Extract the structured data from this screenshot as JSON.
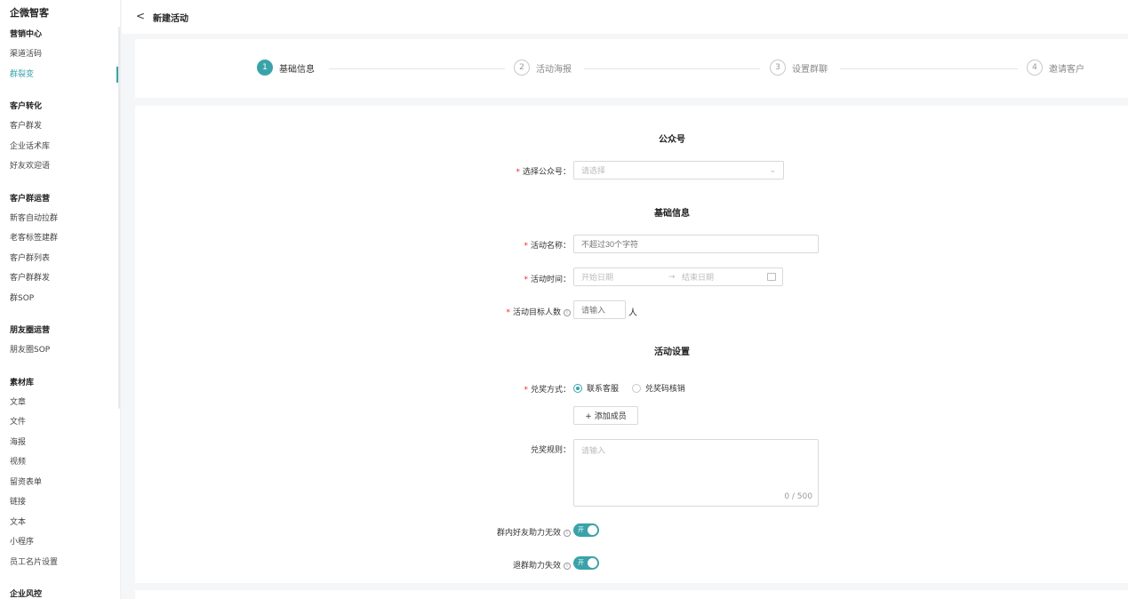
{
  "app": {
    "brand": "企微智客"
  },
  "header": {
    "back": "<",
    "title": "新建活动"
  },
  "sidebar": {
    "groups": [
      {
        "title": "营销中心",
        "items": [
          "渠道活码",
          "群裂变"
        ]
      },
      {
        "title": "客户转化",
        "items": [
          "客户群发",
          "企业话术库",
          "好友欢迎语"
        ]
      },
      {
        "title": "客户群运营",
        "items": [
          "新客自动拉群",
          "老客标签建群",
          "客户群列表",
          "客户群群发",
          "群SOP"
        ]
      },
      {
        "title": "朋友圈运营",
        "items": [
          "朋友圈SOP"
        ]
      },
      {
        "title": "素材库",
        "items": [
          "文章",
          "文件",
          "海报",
          "视频",
          "留资表单",
          "链接",
          "文本",
          "小程序",
          "员工名片设置"
        ]
      },
      {
        "title": "企业风控",
        "items": []
      }
    ],
    "active_item": "群裂变"
  },
  "steps": [
    {
      "num": "1",
      "label": "基础信息",
      "active": true
    },
    {
      "num": "2",
      "label": "活动海报",
      "active": false
    },
    {
      "num": "3",
      "label": "设置群聊",
      "active": false
    },
    {
      "num": "4",
      "label": "邀请客户",
      "active": false
    }
  ],
  "form": {
    "section_account": "公众号",
    "account_label": "选择公众号：",
    "account_placeholder": "请选择",
    "section_basic": "基础信息",
    "name_label": "活动名称：",
    "name_placeholder": "不超过30个字符",
    "time_label": "活动时间：",
    "start_placeholder": "开始日期",
    "arrow": "→",
    "end_placeholder": "结束日期",
    "target_label": "活动目标人数",
    "target_placeholder": "请输入",
    "target_unit": "人",
    "section_settings": "活动设置",
    "redeem_label": "兑奖方式：",
    "redeem_option1": "联系客服",
    "redeem_option2": "兑奖码核销",
    "add_member": "+ 添加成员",
    "rules_label": "兑奖规则：",
    "rules_placeholder": "请输入",
    "rules_counter": "0 / 500",
    "toggle1_label": "群内好友助力无效",
    "toggle2_label": "退群助力失效",
    "toggle_on_text": "开",
    "required_mark": "*",
    "info_mark": "i"
  },
  "colors": {
    "accent": "#3aa3a9",
    "required": "#f5222d"
  }
}
